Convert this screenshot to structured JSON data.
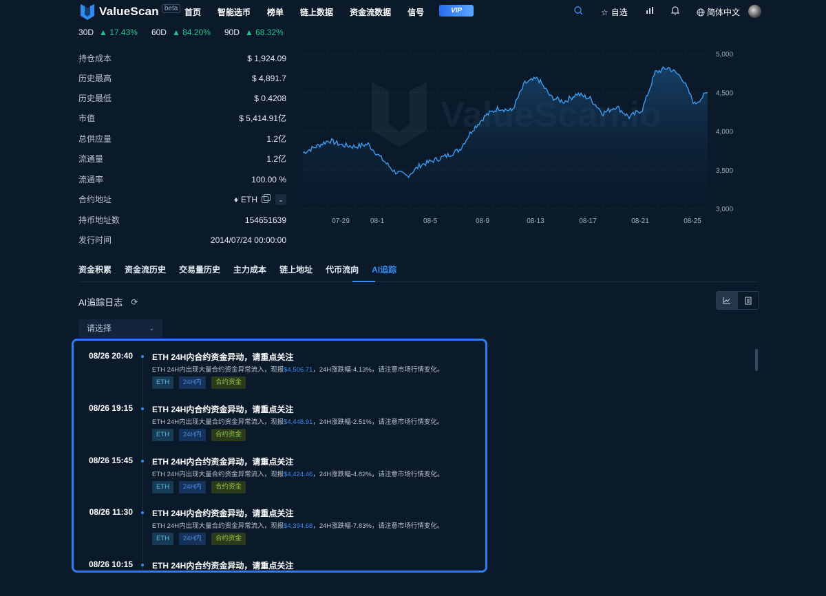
{
  "nav": {
    "brand": "ValueScan",
    "beta": "beta",
    "links": [
      "首页",
      "智能选币",
      "榜单",
      "链上数据",
      "资金流数据",
      "信号"
    ],
    "vip": "VIP",
    "watchlist": "自选",
    "language": "简体中文"
  },
  "perf": [
    {
      "label": "30D",
      "value": "17.43%"
    },
    {
      "label": "60D",
      "value": "84.20%"
    },
    {
      "label": "90D",
      "value": "68.32%"
    }
  ],
  "stats": [
    {
      "key": "持仓成本",
      "value": "$ 1,924.09"
    },
    {
      "key": "历史最高",
      "value": "$ 4,891.7"
    },
    {
      "key": "历史最低",
      "value": "$ 0.4208"
    },
    {
      "key": "市值",
      "value": "$ 5,414.91亿"
    },
    {
      "key": "总供应量",
      "value": "1.2亿"
    },
    {
      "key": "流通量",
      "value": "1.2亿"
    },
    {
      "key": "流通率",
      "value": "100.00 %"
    },
    {
      "key": "合约地址",
      "value": "ETH"
    },
    {
      "key": "持币地址数",
      "value": "154651639"
    },
    {
      "key": "发行时间",
      "value": "2014/07/24 00:00:00"
    }
  ],
  "chart_data": {
    "type": "area",
    "title": "",
    "watermark": "ValueScan.io",
    "x_ticks": [
      "07-29",
      "08-1",
      "08-5",
      "08-9",
      "08-13",
      "08-17",
      "08-21",
      "08-25"
    ],
    "y_ticks": [
      "5,000",
      "4,500",
      "4,000",
      "3,500",
      "3,000"
    ],
    "ylim": [
      3000,
      5000
    ],
    "x": [
      "07-26",
      "07-27",
      "07-28",
      "07-29",
      "07-30",
      "07-31",
      "08-01",
      "08-02",
      "08-03",
      "08-04",
      "08-05",
      "08-06",
      "08-07",
      "08-08",
      "08-09",
      "08-10",
      "08-11",
      "08-12",
      "08-13",
      "08-14",
      "08-15",
      "08-16",
      "08-17",
      "08-18",
      "08-19",
      "08-20",
      "08-21",
      "08-22",
      "08-23",
      "08-24",
      "08-25",
      "08-26"
    ],
    "values": [
      3720,
      3800,
      3880,
      3820,
      3800,
      3830,
      3650,
      3480,
      3420,
      3560,
      3620,
      3680,
      3760,
      4020,
      4200,
      4300,
      4260,
      4620,
      4680,
      4440,
      4380,
      4480,
      4420,
      4230,
      4320,
      4180,
      4280,
      4760,
      4820,
      4700,
      4350,
      4500
    ],
    "line_color": "#3c9bf0",
    "grid": true
  },
  "tabs": [
    "资金积累",
    "资金流历史",
    "交易量历史",
    "主力成本",
    "链上地址",
    "代币流向",
    "AI追踪"
  ],
  "active_tab": "AI追踪",
  "section_title": "AI追踪日志",
  "select_placeholder": "请选择",
  "log": [
    {
      "time": "08/26 20:40",
      "title": "ETH 24H内合约资金异动，请重点关注",
      "desc_pre": "ETH 24H内出现大量合约资金异常流入，现报",
      "price": "$4,506.71",
      "desc_post": "，24H涨跌幅-4.13%，请注意市场行情变化。",
      "tags": [
        "ETH",
        "24H内",
        "合约资金"
      ]
    },
    {
      "time": "08/26 19:15",
      "title": "ETH 24H内合约资金异动，请重点关注",
      "desc_pre": "ETH 24H内出现大量合约资金异常流入，现报",
      "price": "$4,448.91",
      "desc_post": "，24H涨跌幅-2.51%，请注意市场行情变化。",
      "tags": [
        "ETH",
        "24H内",
        "合约资金"
      ]
    },
    {
      "time": "08/26 15:45",
      "title": "ETH 24H内合约资金异动，请重点关注",
      "desc_pre": "ETH 24H内出现大量合约资金异常流入，现报",
      "price": "$4,424.46",
      "desc_post": "，24H涨跌幅-4.82%，请注意市场行情变化。",
      "tags": [
        "ETH",
        "24H内",
        "合约资金"
      ]
    },
    {
      "time": "08/26 11:30",
      "title": "ETH 24H内合约资金异动，请重点关注",
      "desc_pre": "ETH 24H内出现大量合约资金异常流入，现报",
      "price": "$4,394.68",
      "desc_post": "，24H涨跌幅-7.83%，请注意市场行情变化。",
      "tags": [
        "ETH",
        "24H内",
        "合约资金"
      ]
    },
    {
      "time": "08/26 10:15",
      "title": "ETH 24H内合约资金异动，请重点关注"
    }
  ]
}
